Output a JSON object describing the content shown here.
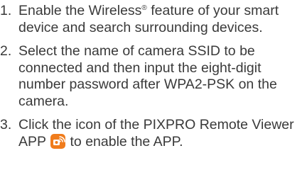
{
  "steps": [
    {
      "number": "1.",
      "text_before": "Enable the Wireless",
      "superscript": "®",
      "text_after": " feature of your smart device and search surrounding devices."
    },
    {
      "number": "2.",
      "text": "Select the name of camera SSID to be connected and then input the eight-digit number password after WPA2-PSK on the camera."
    },
    {
      "number": "3.",
      "text_before": "Click the icon of the PIXPRO Remote Viewer APP ",
      "icon": "pixpro-remote-viewer-app-icon",
      "text_after": " to enable the APP."
    }
  ],
  "colors": {
    "text": "#3a3a3a",
    "app_icon_bg": "#f07c1c",
    "app_icon_fg": "#ffffff"
  }
}
